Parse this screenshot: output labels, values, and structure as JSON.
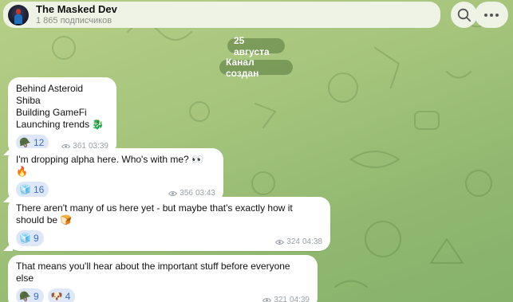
{
  "header": {
    "title": "The Masked Dev",
    "subtitle": "1 865 подписчиков",
    "search_icon": "search-icon",
    "more_icon": "more-dots-icon"
  },
  "service": {
    "date": "25 августа",
    "created": "Канал создан"
  },
  "colors": {
    "bubble": "#ffffff",
    "reaction_bg": "#dde7f7",
    "reaction_text": "#3a6fc4",
    "meta_text": "#9aa0a6",
    "background": "#a5c47c"
  },
  "messages": [
    {
      "text": "Behind Asteroid Shiba\nBuilding GameFi\nLaunching trends 🐉",
      "reactions": [
        {
          "emoji": "🪖",
          "count": "12"
        }
      ],
      "views": "361",
      "time": "03:39"
    },
    {
      "text": "I'm dropping alpha here. Who's with me? 👀 🔥",
      "reactions": [
        {
          "emoji": "🧊",
          "count": "16"
        }
      ],
      "views": "356",
      "time": "03:43"
    },
    {
      "text": "There aren't many of us here yet - but maybe that's exactly how it should be 🍞",
      "reactions": [
        {
          "emoji": "🧊",
          "count": "9"
        }
      ],
      "views": "324",
      "time": "04:38"
    },
    {
      "text": "That means you'll hear about the important stuff before everyone else",
      "reactions": [
        {
          "emoji": "🪖",
          "count": "9"
        },
        {
          "emoji": "🐶",
          "count": "4"
        }
      ],
      "views": "321",
      "time": "04:39"
    }
  ]
}
